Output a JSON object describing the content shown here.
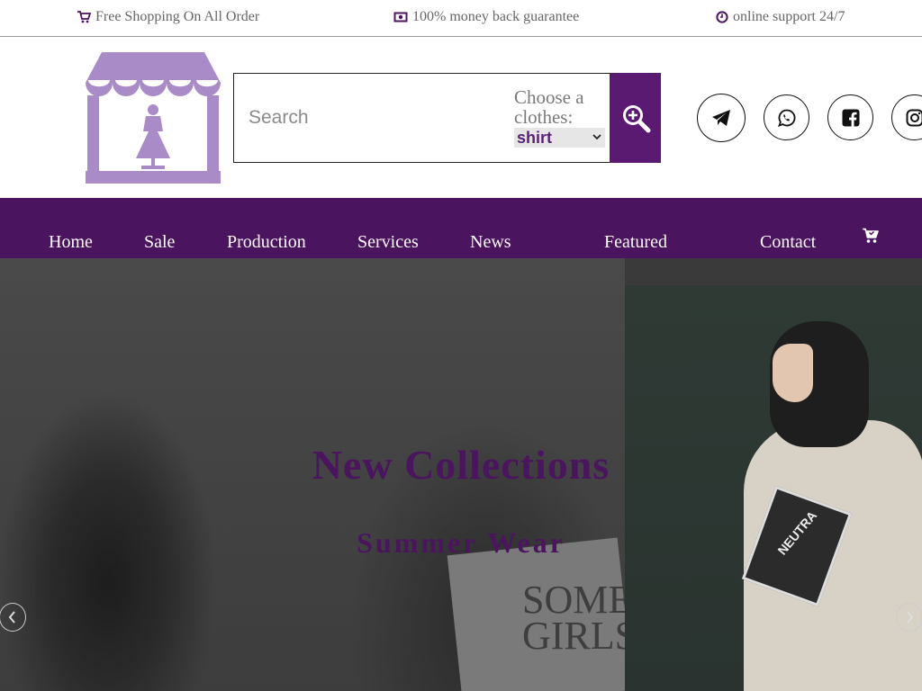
{
  "topbar": {
    "shipping_text": "Free Shopping On All Order",
    "shipping_icon": "cart-icon",
    "guarantee_text": "100% money back guarantee",
    "guarantee_icon": "money-icon",
    "support_text": "online support 24/7",
    "support_icon": "clock-icon"
  },
  "header": {
    "logo_icon": "clothing-store-icon",
    "search": {
      "placeholder": "Search",
      "choose_label": "Choose a clothes:",
      "selected_option": "shirt",
      "button_icon": "search-plus-icon"
    },
    "social": [
      {
        "icon": "telegram-icon"
      },
      {
        "icon": "whatsapp-icon"
      },
      {
        "icon": "facebook-icon"
      },
      {
        "icon": "instagram-icon"
      }
    ]
  },
  "nav": {
    "items": [
      "Home",
      "Sale",
      "Production",
      "Services",
      "News",
      "Featured",
      "Contact"
    ],
    "cart_icon": "cart-icon"
  },
  "hero": {
    "title": "New Collections",
    "subtitle": "Summer Wear",
    "paper_text": "SOME GIRLS",
    "book_text": "NEUTRA"
  },
  "colors": {
    "brand": "#4b145e",
    "search_button": "#5a1a72",
    "logo": "#a98bc8",
    "topbar_text": "#666666"
  }
}
